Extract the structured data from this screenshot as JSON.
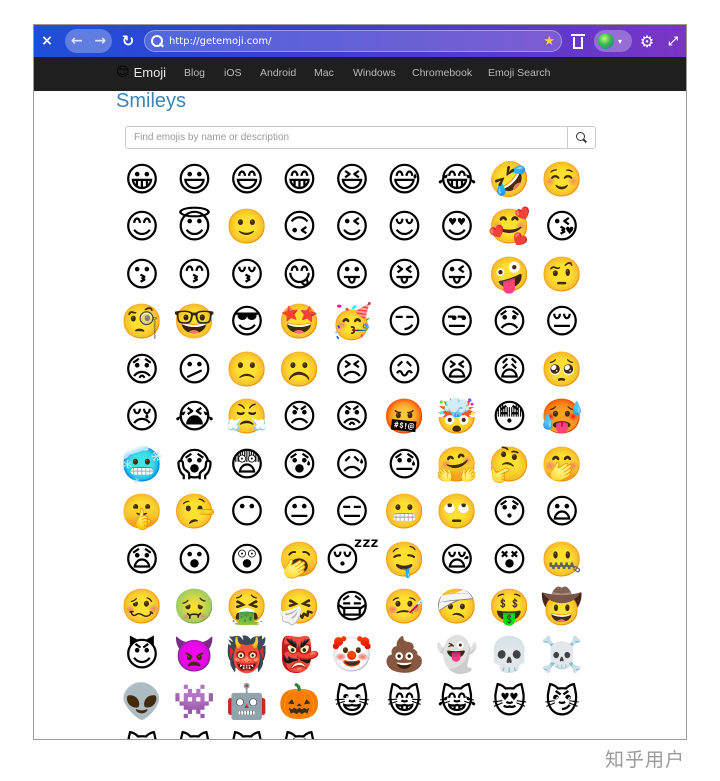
{
  "browser": {
    "close_icon": "×",
    "back_icon": "←",
    "forward_icon": "→",
    "reload_icon": "↻",
    "url": "http://getemoji.com/",
    "bookmark_icon": "★",
    "settings_icon": "⚙",
    "fullscreen_icon": "⤢",
    "extension_caret": "▾"
  },
  "site": {
    "brand_emoji": "😊",
    "brand_name": "Emoji",
    "nav": [
      "Blog",
      "iOS",
      "Android",
      "Mac",
      "Windows",
      "Chromebook",
      "Emoji Search"
    ]
  },
  "page": {
    "title": "Smileys",
    "search_placeholder": "Find emojis by name or description"
  },
  "emojis": [
    "😀",
    "😃",
    "😄",
    "😁",
    "😆",
    "😅",
    "😂",
    "🤣",
    "☺️",
    "😊",
    "😇",
    "🙂",
    "🙃",
    "😉",
    "😌",
    "😍",
    "🥰",
    "😘",
    "😗",
    "😙",
    "😚",
    "😋",
    "😛",
    "😝",
    "😜",
    "🤪",
    "🤨",
    "🧐",
    "🤓",
    "😎",
    "🤩",
    "🥳",
    "😏",
    "😒",
    "😞",
    "😔",
    "😟",
    "😕",
    "🙁",
    "☹️",
    "😣",
    "😖",
    "😫",
    "😩",
    "🥺",
    "😢",
    "😭",
    "😤",
    "😠",
    "😡",
    "🤬",
    "🤯",
    "😳",
    "🥵",
    "🥶",
    "😱",
    "😨",
    "😰",
    "😥",
    "😓",
    "🤗",
    "🤔",
    "🤭",
    "🤫",
    "🤥",
    "😶",
    "😐",
    "😑",
    "😬",
    "🙄",
    "😯",
    "😦",
    "😧",
    "😮",
    "😲",
    "🥱",
    "😴",
    "🤤",
    "😪",
    "😵",
    "🤐",
    "🥴",
    "🤢",
    "🤮",
    "🤧",
    "😷",
    "🤒",
    "🤕",
    "🤑",
    "🤠",
    "😈",
    "👿",
    "👹",
    "👺",
    "🤡",
    "💩",
    "👻",
    "💀",
    "☠️",
    "👽",
    "👾",
    "🤖",
    "🎃",
    "😺",
    "😸",
    "😹",
    "😻",
    "😼",
    "😽",
    "🙀",
    "😿",
    "😾"
  ],
  "watermark": "知乎用户"
}
